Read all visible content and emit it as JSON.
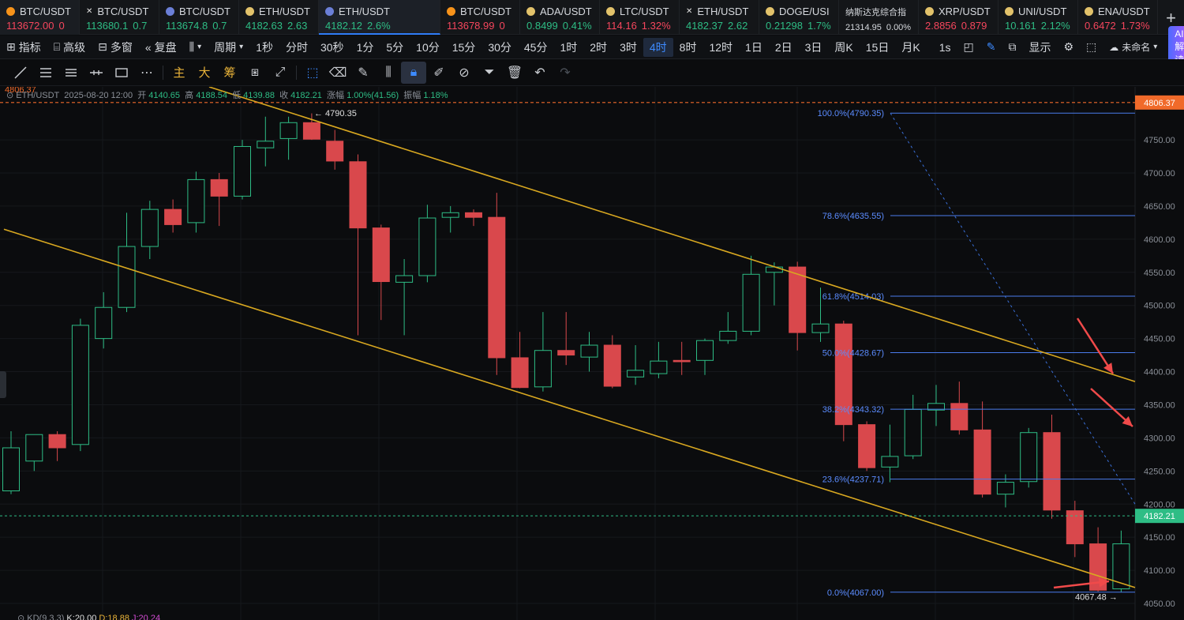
{
  "tickers": [
    {
      "symbol": "BTC/USDT",
      "price": "113672.00",
      "change": "0",
      "dir": "dn",
      "dot": "#f7931a"
    },
    {
      "symbol": "BTC/USDT",
      "price": "113680.1",
      "change": "0.7",
      "dir": "up",
      "dot": "x"
    },
    {
      "symbol": "BTC/USDT",
      "price": "113674.8",
      "change": "0.7",
      "dir": "up",
      "dot": "#6b7fd7"
    },
    {
      "symbol": "ETH/USDT",
      "price": "4182.63",
      "change": "2.63",
      "dir": "up",
      "dot": "#e2c26b"
    },
    {
      "symbol": "ETH/USDT",
      "price": "4182.12",
      "change": "2.6%",
      "dir": "up",
      "dot": "#6b7fd7"
    },
    {
      "symbol": "BTC/USDT",
      "price": "113678.99",
      "change": "0",
      "dir": "dn",
      "dot": "#f7931a"
    },
    {
      "symbol": "ADA/USDT",
      "price": "0.8499",
      "change": "0.41%",
      "dir": "up",
      "dot": "#e2c26b"
    },
    {
      "symbol": "LTC/USDT",
      "price": "114.16",
      "change": "1.32%",
      "dir": "dn",
      "dot": "#e2c26b"
    },
    {
      "symbol": "ETH/USDT",
      "price": "4182.37",
      "change": "2.62",
      "dir": "up",
      "dot": "x"
    },
    {
      "symbol": "DOGE/USI",
      "price": "0.21298",
      "change": "1.7%",
      "dir": "up",
      "dot": "#e2c26b"
    },
    {
      "symbol": "纳斯达克综合指",
      "price": "21314.95",
      "change": "0.00%",
      "dir": "neutral",
      "dot": ""
    },
    {
      "symbol": "XRP/USDT",
      "price": "2.8856",
      "change": "0.879",
      "dir": "dn",
      "dot": "#e2c26b"
    },
    {
      "symbol": "UNI/USDT",
      "price": "10.161",
      "change": "2.12%",
      "dir": "up",
      "dot": "#e2c26b"
    },
    {
      "symbol": "ENA/USDT",
      "price": "0.6472",
      "change": "1.73%",
      "dir": "dn",
      "dot": "#e2c26b"
    }
  ],
  "toolbar": {
    "indicators": "指标",
    "advanced": "高级",
    "multi_window": "多窗",
    "replay": "复盘",
    "period": "周期",
    "intervals": [
      "1秒",
      "分时",
      "30秒",
      "1分",
      "5分",
      "10分",
      "15分",
      "30分",
      "45分",
      "1时",
      "2时",
      "3时",
      "4时",
      "8时",
      "12时",
      "1日",
      "2日",
      "3日",
      "周K",
      "15日",
      "月K"
    ],
    "active_interval": "4时",
    "one_s": "1s",
    "display": "显示",
    "unnamed": "未命名",
    "ai": "AI解读"
  },
  "tools": {
    "main": "主",
    "big": "大",
    "chips": "筹"
  },
  "ohlc": {
    "symbol": "ETH/USDT",
    "datetime": "2025-08-20 12:00",
    "open_label": "开",
    "open": "4140.65",
    "high_label": "高",
    "high": "4188.54",
    "low_label": "低",
    "low": "4139.88",
    "close_label": "收",
    "close": "4182.21",
    "change_label": "涨幅",
    "change": "1.00%(41.56)",
    "amp_label": "振幅",
    "amp": "1.18%"
  },
  "indicator_line": {
    "name": "KD(9,3,3)",
    "k": "K:20.00",
    "d": "D:18.88",
    "j": "J:20.24"
  },
  "colors": {
    "up": "#2ebd85",
    "down": "#d9484c",
    "accent": "#2f7cf6",
    "trend": "#d9a820",
    "fib": "#4b7bec",
    "alert": "#f06a2a"
  },
  "chart_data": {
    "type": "candlestick",
    "ylim": [
      4025,
      4830
    ],
    "y_ticks": [
      4050,
      4100,
      4150,
      4200,
      4250,
      4300,
      4350,
      4400,
      4450,
      4500,
      4550,
      4600,
      4650,
      4700,
      4750
    ],
    "candles": [
      {
        "o": 4220,
        "h": 4310,
        "l": 4215,
        "c": 4285
      },
      {
        "o": 4265,
        "h": 4300,
        "l": 4250,
        "c": 4305
      },
      {
        "o": 4305,
        "h": 4310,
        "l": 4265,
        "c": 4285
      },
      {
        "o": 4290,
        "h": 4480,
        "l": 4280,
        "c": 4470
      },
      {
        "o": 4450,
        "h": 4520,
        "l": 4435,
        "c": 4497
      },
      {
        "o": 4497,
        "h": 4640,
        "l": 4490,
        "c": 4589
      },
      {
        "o": 4589,
        "h": 4658,
        "l": 4570,
        "c": 4645
      },
      {
        "o": 4645,
        "h": 4660,
        "l": 4610,
        "c": 4622
      },
      {
        "o": 4625,
        "h": 4702,
        "l": 4610,
        "c": 4690
      },
      {
        "o": 4690,
        "h": 4700,
        "l": 4620,
        "c": 4665
      },
      {
        "o": 4665,
        "h": 4750,
        "l": 4660,
        "c": 4740
      },
      {
        "o": 4738,
        "h": 4785,
        "l": 4710,
        "c": 4748
      },
      {
        "o": 4752,
        "h": 4785,
        "l": 4720,
        "c": 4776
      },
      {
        "o": 4776,
        "h": 4790,
        "l": 4750,
        "c": 4751
      },
      {
        "o": 4748,
        "h": 4765,
        "l": 4705,
        "c": 4718
      },
      {
        "o": 4717,
        "h": 4728,
        "l": 4455,
        "c": 4617
      },
      {
        "o": 4617,
        "h": 4622,
        "l": 4478,
        "c": 4536
      },
      {
        "o": 4535,
        "h": 4570,
        "l": 4455,
        "c": 4545
      },
      {
        "o": 4545,
        "h": 4652,
        "l": 4535,
        "c": 4632
      },
      {
        "o": 4633,
        "h": 4650,
        "l": 4610,
        "c": 4640
      },
      {
        "o": 4640,
        "h": 4645,
        "l": 4620,
        "c": 4633
      },
      {
        "o": 4633,
        "h": 4670,
        "l": 4395,
        "c": 4421
      },
      {
        "o": 4421,
        "h": 4460,
        "l": 4375,
        "c": 4376
      },
      {
        "o": 4377,
        "h": 4490,
        "l": 4370,
        "c": 4432
      },
      {
        "o": 4432,
        "h": 4490,
        "l": 4410,
        "c": 4425
      },
      {
        "o": 4422,
        "h": 4460,
        "l": 4400,
        "c": 4440
      },
      {
        "o": 4440,
        "h": 4455,
        "l": 4375,
        "c": 4378
      },
      {
        "o": 4392,
        "h": 4440,
        "l": 4380,
        "c": 4402
      },
      {
        "o": 4397,
        "h": 4445,
        "l": 4390,
        "c": 4416
      },
      {
        "o": 4417,
        "h": 4445,
        "l": 4395,
        "c": 4415
      },
      {
        "o": 4417,
        "h": 4450,
        "l": 4395,
        "c": 4447
      },
      {
        "o": 4447,
        "h": 4490,
        "l": 4442,
        "c": 4461
      },
      {
        "o": 4461,
        "h": 4575,
        "l": 4455,
        "c": 4547
      },
      {
        "o": 4550,
        "h": 4565,
        "l": 4500,
        "c": 4558
      },
      {
        "o": 4558,
        "h": 4566,
        "l": 4432,
        "c": 4459
      },
      {
        "o": 4459,
        "h": 4527,
        "l": 4445,
        "c": 4472
      },
      {
        "o": 4472,
        "h": 4477,
        "l": 4295,
        "c": 4320
      },
      {
        "o": 4320,
        "h": 4325,
        "l": 4250,
        "c": 4255
      },
      {
        "o": 4256,
        "h": 4320,
        "l": 4233,
        "c": 4272
      },
      {
        "o": 4273,
        "h": 4365,
        "l": 4268,
        "c": 4343
      },
      {
        "o": 4342,
        "h": 4380,
        "l": 4318,
        "c": 4352
      },
      {
        "o": 4352,
        "h": 4385,
        "l": 4305,
        "c": 4312
      },
      {
        "o": 4312,
        "h": 4355,
        "l": 4210,
        "c": 4215
      },
      {
        "o": 4215,
        "h": 4245,
        "l": 4195,
        "c": 4233
      },
      {
        "o": 4234,
        "h": 4315,
        "l": 4225,
        "c": 4308
      },
      {
        "o": 4308,
        "h": 4335,
        "l": 4178,
        "c": 4191
      },
      {
        "o": 4190,
        "h": 4205,
        "l": 4120,
        "c": 4140
      },
      {
        "o": 4140,
        "h": 4165,
        "l": 4068,
        "c": 4070
      },
      {
        "o": 4072,
        "h": 4160,
        "l": 4067,
        "c": 4140
      }
    ],
    "current_price": "4182.21",
    "alert_price": "4806.37",
    "high_marker": "4790.35",
    "low_marker": "4067.48",
    "fib_levels": [
      {
        "label": "100.0%(4790.35)",
        "price": 4790.35
      },
      {
        "label": "78.6%(4635.55)",
        "price": 4635.55
      },
      {
        "label": "61.8%(4514.03)",
        "price": 4514.03
      },
      {
        "label": "50.0%(4428.67)",
        "price": 4428.67
      },
      {
        "label": "38.2%(4343.32)",
        "price": 4343.32
      },
      {
        "label": "23.6%(4237.71)",
        "price": 4237.71
      },
      {
        "label": "0.0%(4067.00)",
        "price": 4067.0
      }
    ]
  }
}
